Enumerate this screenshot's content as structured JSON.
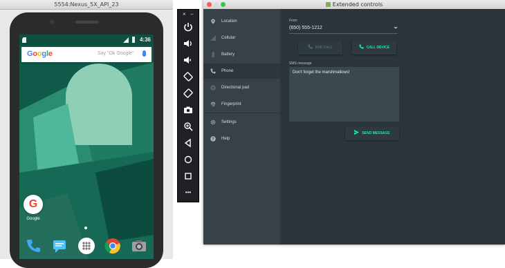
{
  "emulator": {
    "window_title": "5554:Nexus_5X_API_23",
    "status_bar": {
      "time": "4:36"
    },
    "search_bar": {
      "logo": "Google",
      "hint": "Say \"Ok Google\""
    },
    "home_apps": [
      {
        "icon": "google-app-icon",
        "label": "Google"
      }
    ],
    "dock_apps": [
      "phone-app-icon",
      "messages-app-icon",
      "app-drawer-icon",
      "chrome-app-icon",
      "camera-app-icon"
    ]
  },
  "toolbar": {
    "close_label": "×",
    "minimize_label": "−",
    "buttons": [
      "power-icon",
      "volume-up-icon",
      "volume-down-icon",
      "rotate-left-icon",
      "rotate-right-icon",
      "camera-icon",
      "zoom-icon",
      "back-icon",
      "home-icon",
      "overview-icon",
      "more-icon"
    ],
    "more_label": "•••"
  },
  "extended_controls": {
    "title": "Extended controls",
    "nav": [
      {
        "label": "Location",
        "icon": "location-icon",
        "active": false
      },
      {
        "label": "Cellular",
        "icon": "cellular-icon",
        "active": false
      },
      {
        "label": "Battery",
        "icon": "battery-icon",
        "active": false
      },
      {
        "label": "Phone",
        "icon": "phone-icon",
        "active": true
      },
      {
        "label": "Directional pad",
        "icon": "dpad-icon",
        "active": false
      },
      {
        "label": "Fingerprint",
        "icon": "fingerprint-icon",
        "active": false
      },
      {
        "label": "Settings",
        "icon": "settings-icon",
        "active": false
      },
      {
        "label": "Help",
        "icon": "help-icon",
        "active": false
      }
    ],
    "phone": {
      "from_label": "From",
      "from_value": "(650) 555-1212",
      "end_call_label": "END CALL",
      "call_device_label": "CALL DEVICE",
      "sms_label": "SMS message",
      "sms_value": "Don't forget the marshmallows!",
      "send_label": "SEND MESSAGE"
    },
    "colors": {
      "accent": "#1de9b6",
      "disabled": "#4f6e69",
      "panel": "#2a353b",
      "nav": "#374248"
    }
  }
}
